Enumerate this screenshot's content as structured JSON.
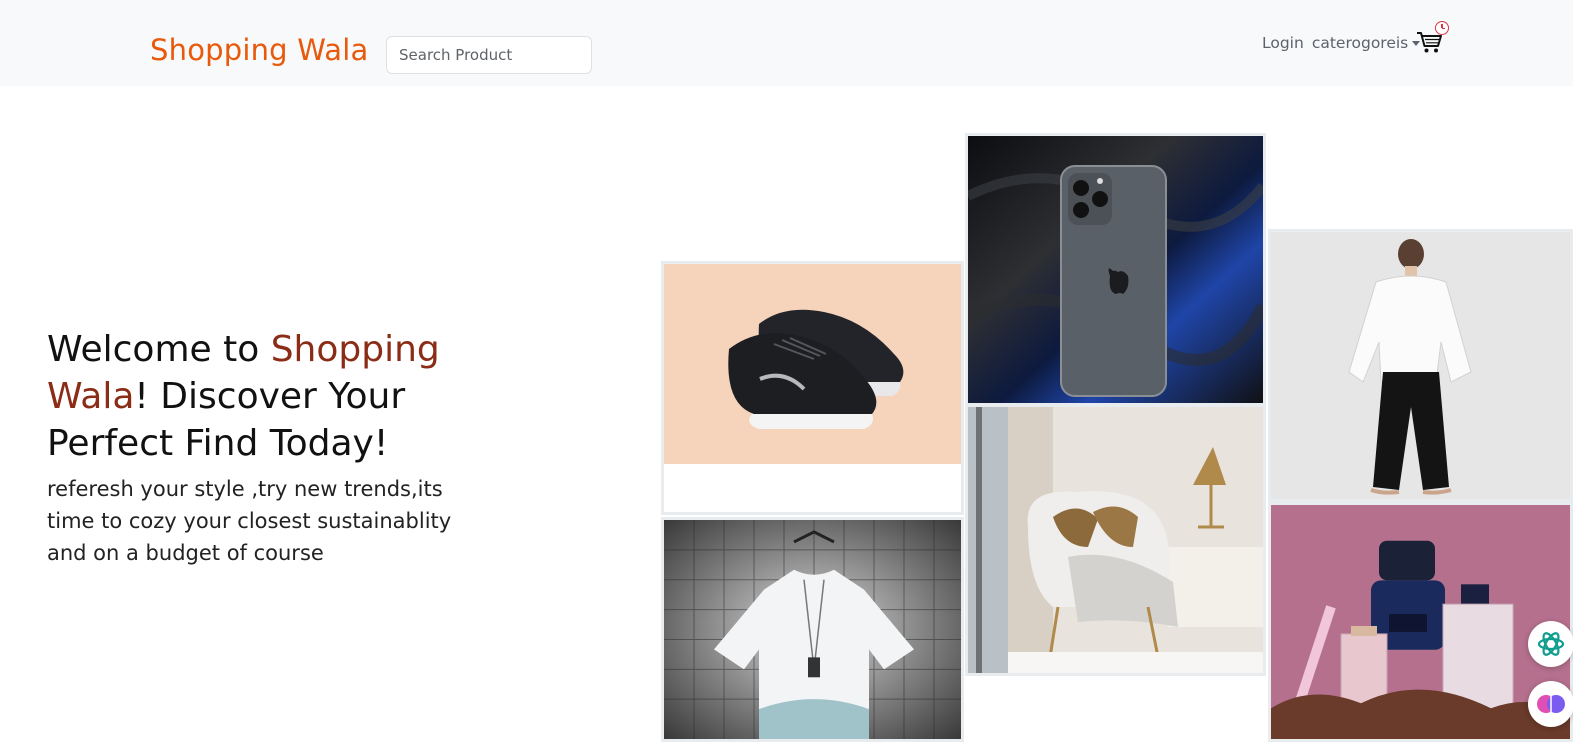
{
  "navbar": {
    "brand": "Shopping Wala",
    "search_placeholder": "Search Product",
    "login_label": "Login",
    "categories_label": "caterogoreis",
    "cart_icon": "cart-icon",
    "badge_icon": "clock-badge-icon"
  },
  "hero": {
    "title_prefix": "Welcome to ",
    "title_accent": "Shopping Wala",
    "title_suffix": "! Discover Your Perfect Find Today!",
    "subtitle": "referesh your style ,try new trends,its time to cozy your closest sustainablity and on a budget of course"
  },
  "gallery": {
    "items": [
      {
        "name": "sneakers-image",
        "subject": "black running sneakers"
      },
      {
        "name": "tshirt-image",
        "subject": "white graphic t-shirt"
      },
      {
        "name": "phone-image",
        "subject": "smartphone on black silk"
      },
      {
        "name": "chair-image",
        "subject": "armchair with pillows"
      },
      {
        "name": "fashion-image",
        "subject": "woman in white shirt and black trousers"
      },
      {
        "name": "perfume-image",
        "subject": "perfume bottles"
      }
    ]
  },
  "colors": {
    "brand": "#e8590c",
    "accent": "#8b2c16",
    "navbar_bg": "#f8f9fa"
  }
}
